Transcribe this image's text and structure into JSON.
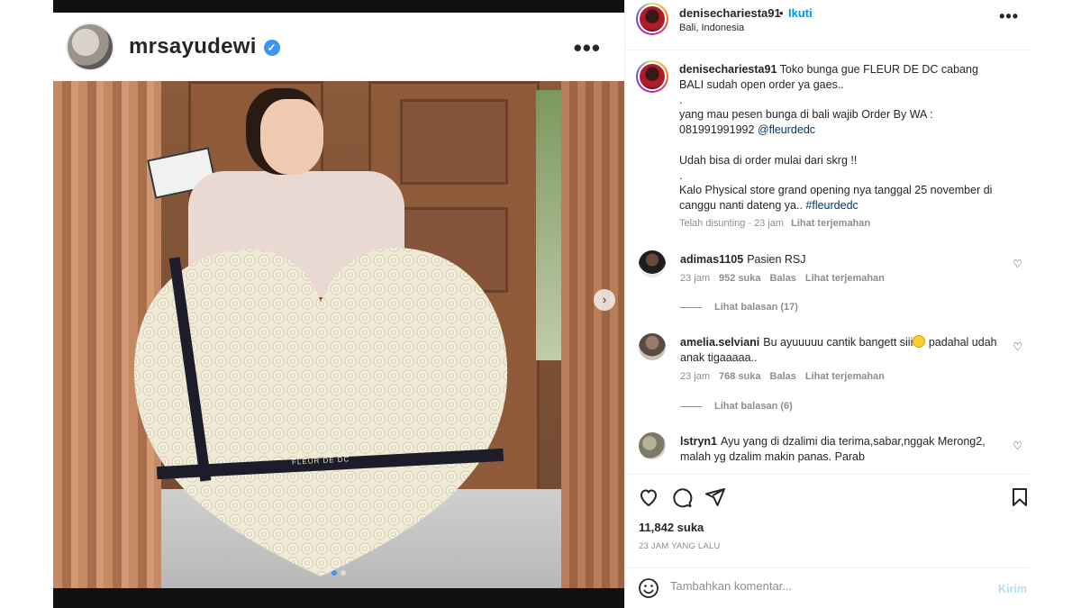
{
  "embed": {
    "username": "mrsayudewi",
    "verified_icon": "verified-badge-icon",
    "more_label": "•••",
    "ribbon_text": "FLEUR DE DC",
    "next_label": "›",
    "slides_total": 2,
    "slide_active": 1
  },
  "header": {
    "username": "denisechariesta91",
    "dot": "•",
    "follow_label": "Ikuti",
    "location": "Bali, Indonesia",
    "more_label": "•••"
  },
  "caption": {
    "username": "denisechariesta91",
    "text": " Toko bunga gue FLEUR DE DC cabang BALI sudah open order ya gaes..\n.\nyang mau pesen bunga di bali wajib Order By WA :\n081991991992 ",
    "mention": "@fleurdedc",
    "text2": "\n\nUdah bisa di order mulai dari skrg !!\n.\nKalo Physical store grand opening nya tanggal 25 november di canggu nanti dateng ya.. ",
    "hashtag": "#fleurdedc",
    "edited": "Telah disunting",
    "sep": "·",
    "time": "23 jam",
    "translate": "Lihat terjemahan"
  },
  "comments": [
    {
      "username": "adimas1105",
      "text": "Pasien RSJ",
      "time": "23 jam",
      "likes": "952 suka",
      "reply": "Balas",
      "translate": "Lihat terjemahan",
      "replies": "Lihat balasan (17)"
    },
    {
      "username": "amelia.selviani",
      "text_a": "Bu ayuuuuu cantik bangett siii",
      "text_b": " padahal udah anak tigaaaaa..",
      "time": "23 jam",
      "likes": "768 suka",
      "reply": "Balas",
      "translate": "Lihat terjemahan",
      "replies": "Lihat balasan (6)"
    },
    {
      "username": "lstryn1",
      "text": "Ayu yang di dzalimi dia terima,sabar,nggak Merong2, malah yg dzalim makin panas. Parab"
    }
  ],
  "actions": {
    "like_icon": "heart-icon",
    "comment_icon": "comment-icon",
    "share_icon": "share-icon",
    "save_icon": "bookmark-icon",
    "likes": "11,842 suka",
    "time_ago": "23 JAM YANG LALU"
  },
  "comment_box": {
    "placeholder": "Tambahkan komentar...",
    "post_label": "Kirim"
  },
  "colors": {
    "accent": "#0095f6",
    "verified": "#3897f0",
    "muted": "#8e8e8e",
    "post_disabled": "#b2dffc"
  }
}
